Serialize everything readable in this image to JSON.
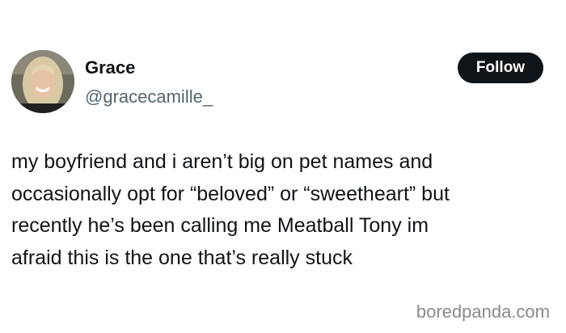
{
  "tweet": {
    "display_name": "Grace",
    "handle": "@gracecamille_",
    "follow_label": "Follow",
    "text_lines": [
      "my boyfriend and i aren’t big on pet names and",
      "occasionally opt for “beloved” or “sweetheart” but",
      "recently he’s been calling me Meatball Tony im",
      "afraid this is the one that’s really stuck"
    ]
  },
  "watermark": "boredpanda.com",
  "colors": {
    "text": "#0f1419",
    "handle": "#536471",
    "button_bg": "#0f1419",
    "button_text": "#ffffff",
    "watermark": "#8a8a8a"
  }
}
